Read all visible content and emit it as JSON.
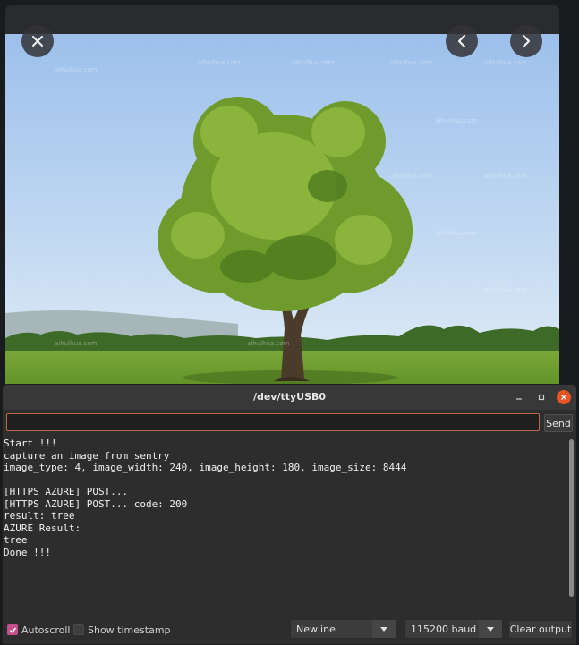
{
  "viewer": {
    "watermark": "aihuihua.com",
    "icons": {
      "close": "close-icon",
      "prev": "chevron-left-icon",
      "next": "chevron-right-icon"
    }
  },
  "monitor": {
    "title": "/dev/ttyUSB0",
    "send_input": {
      "value": "",
      "placeholder": ""
    },
    "send_label": "Send",
    "output_lines": [
      "Start !!!",
      "capture an image from sentry",
      "image_type: 4, image_width: 240, image_height: 180, image_size: 8444",
      "",
      "[HTTPS AZURE] POST...",
      "[HTTPS AZURE] POST... code: 200",
      "result: tree",
      "AZURE Result:",
      "tree",
      "Done !!!"
    ],
    "footer": {
      "autoscroll_label": "Autoscroll",
      "autoscroll_checked": true,
      "timestamp_label": "Show timestamp",
      "timestamp_checked": false,
      "line_ending": "Newline",
      "baud": "115200 baud",
      "clear_label": "Clear output"
    },
    "colors": {
      "accent": "#c5508d",
      "close": "#e95420",
      "input_border": "#b86848"
    }
  }
}
